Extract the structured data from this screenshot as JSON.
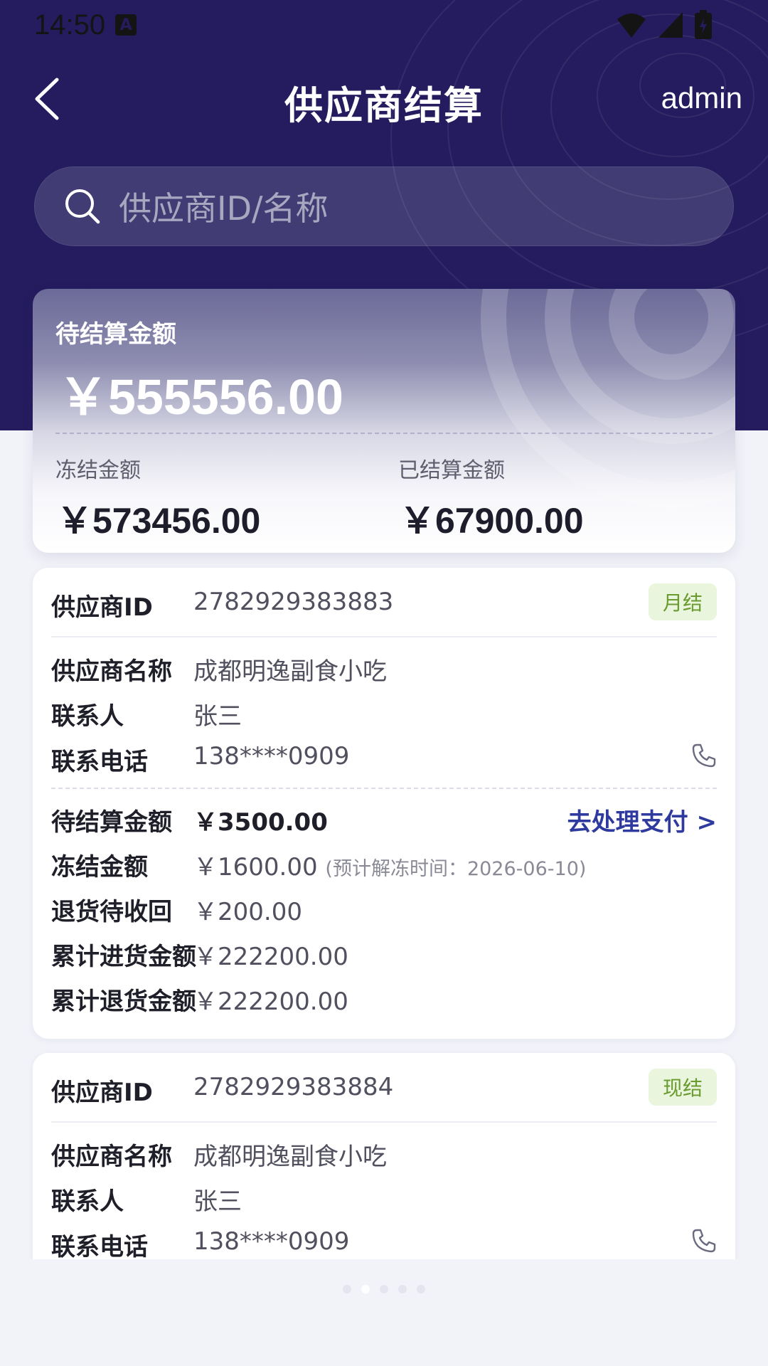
{
  "status_bar": {
    "time": "14:50",
    "notification_letter": "A"
  },
  "nav": {
    "title": "供应商结算",
    "user": "admin"
  },
  "search": {
    "placeholder": "供应商ID/名称"
  },
  "summary": {
    "pending_label": "待结算金额",
    "pending_value": "￥555556.00",
    "frozen_label": "冻结金额",
    "frozen_value": "￥573456.00",
    "settled_label": "已结算金额",
    "settled_value": "￥67900.00"
  },
  "labels": {
    "supplier_id": "供应商ID",
    "supplier_name": "供应商名称",
    "contact": "联系人",
    "phone": "联系电话",
    "pending": "待结算金额",
    "frozen": "冻结金额",
    "return_pending": "退货待收回",
    "total_purchase": "累计进货金额",
    "total_return": "累计退货金额"
  },
  "suppliers": [
    {
      "id": "2782929383883",
      "badge": "月结",
      "name": "成都明逸副食小吃",
      "contact": "张三",
      "phone": "138****0909",
      "pending": "￥3500.00",
      "action": "去处理支付 >",
      "frozen": "￥1600.00",
      "frozen_note": "(预计解冻时间：2026-06-10)",
      "return_pending": "￥200.00",
      "total_purchase": "￥222200.00",
      "total_return": "￥222200.00"
    },
    {
      "id": "2782929383884",
      "badge": "现结",
      "name": "成都明逸副食小吃",
      "contact": "张三",
      "phone": "138****0909"
    }
  ],
  "colors": {
    "header_bg": "#241c5e",
    "accent_link": "#2f3a9e",
    "badge_bg": "#e9f5dc",
    "badge_text": "#6a9b2e"
  }
}
